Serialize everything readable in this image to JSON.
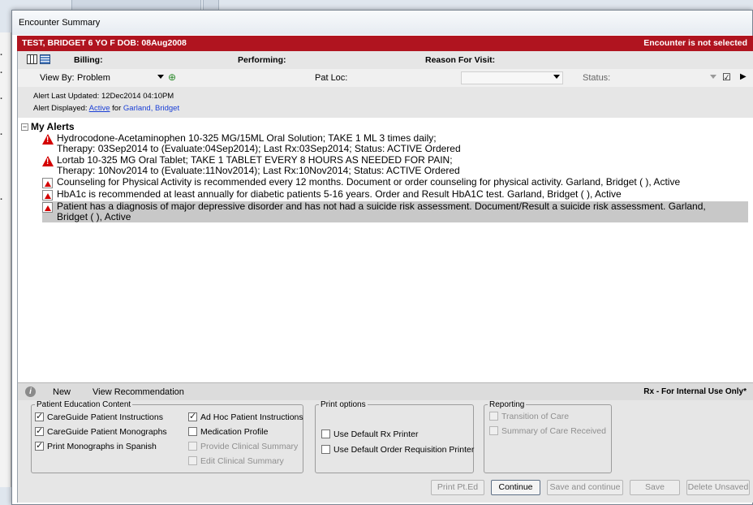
{
  "window": {
    "title": "Encounter Summary"
  },
  "patient_bar": {
    "patient": "TEST, BRIDGET  6 YO  F DOB: 08Aug2008",
    "encounter_status": "Encounter is not selected"
  },
  "header_row": {
    "billing": "Billing:",
    "performing": "Performing:",
    "reason": "Reason For Visit:"
  },
  "view_row": {
    "view_by_label": "View By:",
    "view_by_value": "Problem",
    "pat_loc": "Pat Loc:",
    "status": "Status:"
  },
  "alert_info": {
    "last_updated": "Alert Last Updated: 12Dec2014 04:10PM",
    "displayed_label": "Alert Displayed:",
    "displayed_value": "Active",
    "for_label": "for",
    "for_value": "Garland, Bridget"
  },
  "alerts": {
    "group_title": "My Alerts",
    "items": [
      {
        "icon": "warning-icon",
        "line1": "Hydrocodone-Acetaminophen 10-325 MG/15ML Oral Solution; TAKE 1 ML 3 times daily;",
        "line2": "Therapy:  03Sep2014 to (Evaluate:04Sep2014); Last Rx:03Sep2014; Status: ACTIVE Ordered"
      },
      {
        "icon": "warning-icon",
        "line1": "Lortab 10-325 MG Oral Tablet; TAKE 1 TABLET EVERY 8 HOURS AS NEEDED FOR PAIN;",
        "line2": "Therapy:  10Nov2014 to (Evaluate:11Nov2014); Last Rx:10Nov2014; Status: ACTIVE Ordered"
      },
      {
        "icon": "lab-flask-icon",
        "line1": "Counseling for Physical Activity is recommended every 12 months. Document or order counseling for physical activity. Garland, Bridget ( ), Active",
        "line2": ""
      },
      {
        "icon": "lab-flask-icon",
        "line1": "HbA1c is recommended at least annually for diabetic patients 5-16 years. Order and Result HbA1C test. Garland, Bridget ( ), Active",
        "line2": ""
      },
      {
        "icon": "lab-flask-icon",
        "line1": "Patient has a diagnosis of major depressive disorder and has not had a suicide risk assessment. Document/Result a suicide risk assessment. Garland,",
        "line2": "Bridget ( ), Active"
      }
    ]
  },
  "bottom_bar": {
    "new": "New",
    "view_recommendation": "View Recommendation",
    "rx_notice": "Rx - For Internal Use Only*"
  },
  "patient_education": {
    "legend": "Patient Education Content",
    "careguide_instructions": "CareGuide Patient Instructions",
    "careguide_monographs": "CareGuide Patient Monographs",
    "print_spanish": "Print Monographs in Spanish",
    "adhoc": "Ad Hoc Patient Instructions",
    "medication_profile": "Medication Profile",
    "provide_summary": "Provide Clinical Summary",
    "edit_summary": "Edit Clinical Summary"
  },
  "print_options": {
    "legend": "Print options",
    "rx_printer": "Use Default Rx Printer",
    "order_printer": "Use Default Order Requisition Printer"
  },
  "reporting": {
    "legend": "Reporting",
    "transition": "Transition of Care",
    "summary_received": "Summary of Care Received"
  },
  "buttons": {
    "print_pt_ed": "Print Pt.Ed",
    "continue": "Continue",
    "save_continue": "Save and continue",
    "save": "Save",
    "delete_unsaved": "Delete Unsaved"
  },
  "colors": {
    "patient_bar": "#b0141f",
    "link": "#1a3fd6",
    "highlight_row": "#c8c8c8"
  }
}
